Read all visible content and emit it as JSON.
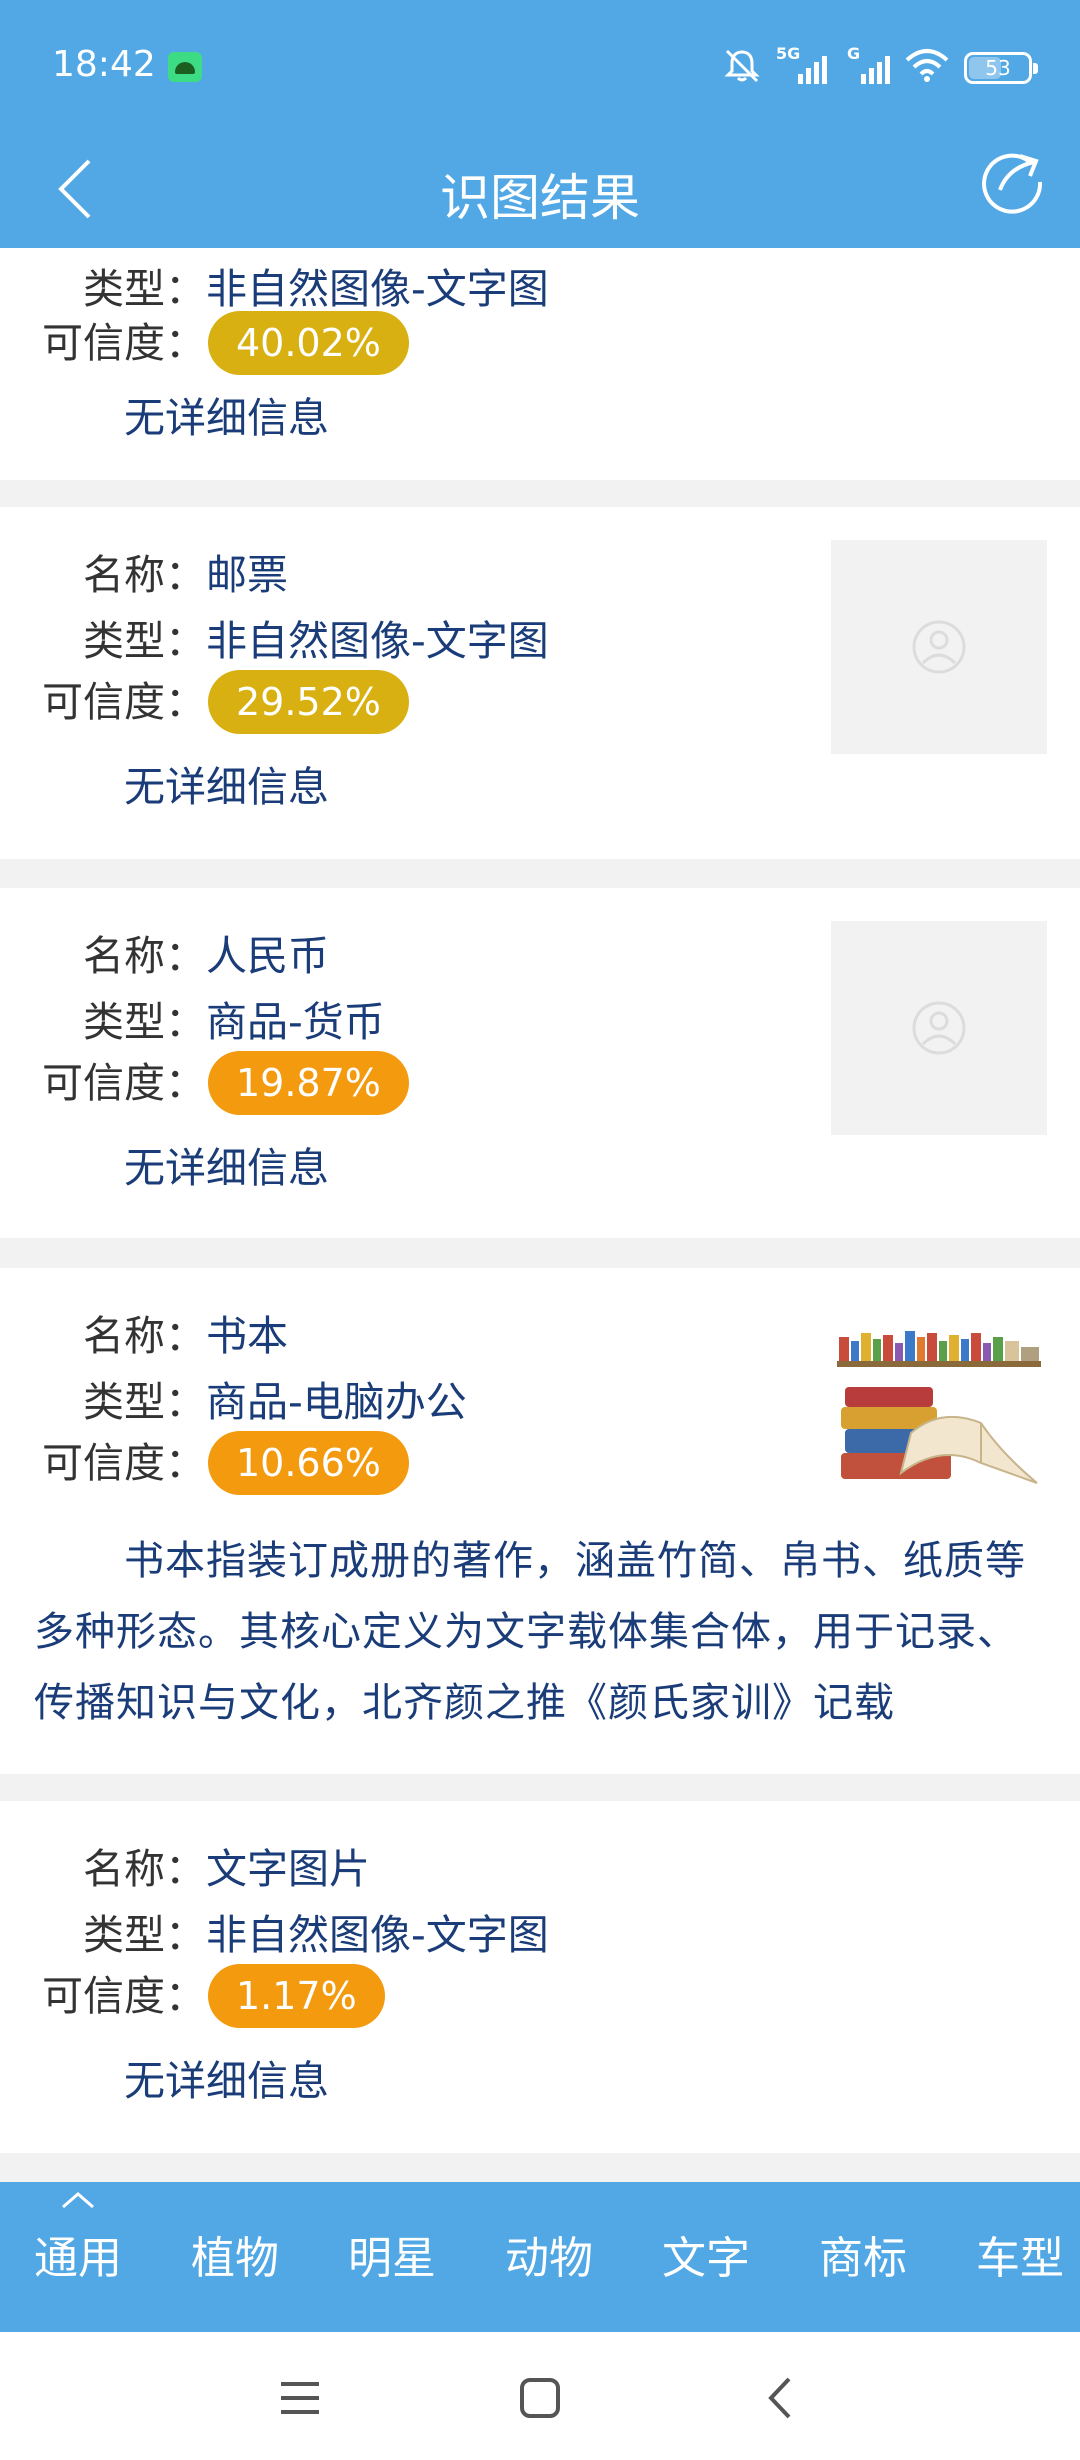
{
  "status_bar": {
    "time": "18:42",
    "battery": "53",
    "signal_1_tag": "5G",
    "signal_2_tag": "G",
    "icons": [
      "android-notification-icon",
      "mute-bell-icon",
      "signal-5g-icon",
      "signal-g-icon",
      "wifi-icon",
      "battery-icon"
    ]
  },
  "app_bar": {
    "title": "识图结果",
    "back_icon": "back-chevron-icon",
    "share_icon": "share-icon"
  },
  "labels": {
    "name": "名称：",
    "type": "类型：",
    "confidence": "可信度："
  },
  "colors": {
    "header": "#52a8e4",
    "badge_yellow": "#d9b011",
    "badge_orange": "#f39a0e",
    "value_text": "#1a3c78"
  },
  "results": [
    {
      "type": "非自然图像-文字图",
      "confidence": "40.02%",
      "detail": "无详细信息"
    },
    {
      "name": "邮票",
      "type": "非自然图像-文字图",
      "confidence": "29.52%",
      "detail": "无详细信息"
    },
    {
      "name": "人民币",
      "type": "商品-货币",
      "confidence": "19.87%",
      "detail": "无详细信息"
    },
    {
      "name": "书本",
      "type": "商品-电脑办公",
      "confidence": "10.66%",
      "description": "书本指装订成册的著作，涵盖竹简、帛书、纸质等多种形态。其核心定义为文字载体集合体，用于记录、传播知识与文化，北齐颜之推《颜氏家训》记载"
    },
    {
      "name": "文字图片",
      "type": "非自然图像-文字图",
      "confidence": "1.17%",
      "detail": "无详细信息"
    }
  ],
  "tabs": [
    "通用",
    "植物",
    "明星",
    "动物",
    "文字",
    "商标",
    "车型"
  ],
  "nav_bar": [
    "menu-icon",
    "home-square-icon",
    "back-icon"
  ]
}
